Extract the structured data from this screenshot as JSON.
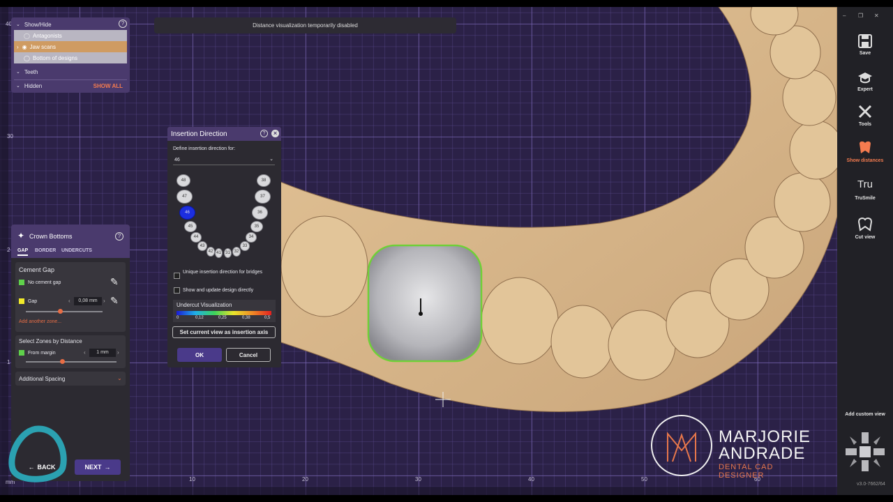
{
  "banner": "Distance visualization temporarily disabled",
  "show_hide": {
    "title": "Show/Hide",
    "items": [
      {
        "label": "Antagonists"
      },
      {
        "label": "Jaw scans"
      },
      {
        "label": "Bottom of designs"
      }
    ],
    "teeth": "Teeth",
    "hidden": "Hidden",
    "show_all": "SHOW ALL"
  },
  "crown_bottoms": {
    "title": "Crown Bottoms",
    "tabs": [
      "GAP",
      "BORDER",
      "UNDERCUTS"
    ],
    "cement_gap": {
      "title": "Cement Gap",
      "no_cement": "No cement gap",
      "gap_label": "Gap",
      "gap_value": "0,08 mm",
      "gap_slider_fraction": 0.45,
      "add_zone": "Add another zone..."
    },
    "select_zones": {
      "title": "Select Zones by Distance",
      "from_margin": "From margin",
      "margin_value": "1 mm",
      "margin_slider_fraction": 0.4
    },
    "additional_spacing": "Additional Spacing"
  },
  "nav": {
    "back": "BACK",
    "next": "NEXT"
  },
  "dialog": {
    "title": "Insertion Direction",
    "define_label": "Define insertion direction for:",
    "selected_tooth": "46",
    "teeth_left": [
      "48",
      "47",
      "46",
      "45",
      "44",
      "43",
      "42",
      "41"
    ],
    "teeth_right": [
      "38",
      "37",
      "36",
      "35",
      "34",
      "33",
      "32",
      "31"
    ],
    "unique_label": "Unique insertion direction for bridges",
    "show_update_label": "Show and update design directly",
    "undercut_title": "Undercut Visualization",
    "scale_ticks": [
      "0",
      "0,12",
      "0,25",
      "0,38",
      "0,5"
    ],
    "set_axis": "Set current view as insertion axis",
    "ok": "OK",
    "cancel": "Cancel"
  },
  "toolbar": {
    "save": "Save",
    "expert": "Expert",
    "tools": "Tools",
    "show_distances": "Show distances",
    "trusmile": "TruSmile",
    "trusmile_logo": "Tru",
    "cut_view": "Cut view",
    "add_custom_view": "Add custom view"
  },
  "axis": {
    "x_ticks": [
      "10",
      "20",
      "30",
      "40",
      "50",
      "60"
    ],
    "y_ticks": [
      "40",
      "30",
      "2",
      "1"
    ],
    "unit": "mm"
  },
  "watermark": {
    "line1": "MARJORIE",
    "line2": "ANDRADE",
    "line3": "DENTAL CAD DESIGNER"
  },
  "version": "v3.0-7662/64",
  "colors": {
    "accent": "#f47b4f",
    "panel_purple": "#4a3a6d",
    "ok_button": "#4a3a8a",
    "tooth_selected": "#1c2ee0",
    "jaw": "#d9b98e"
  }
}
